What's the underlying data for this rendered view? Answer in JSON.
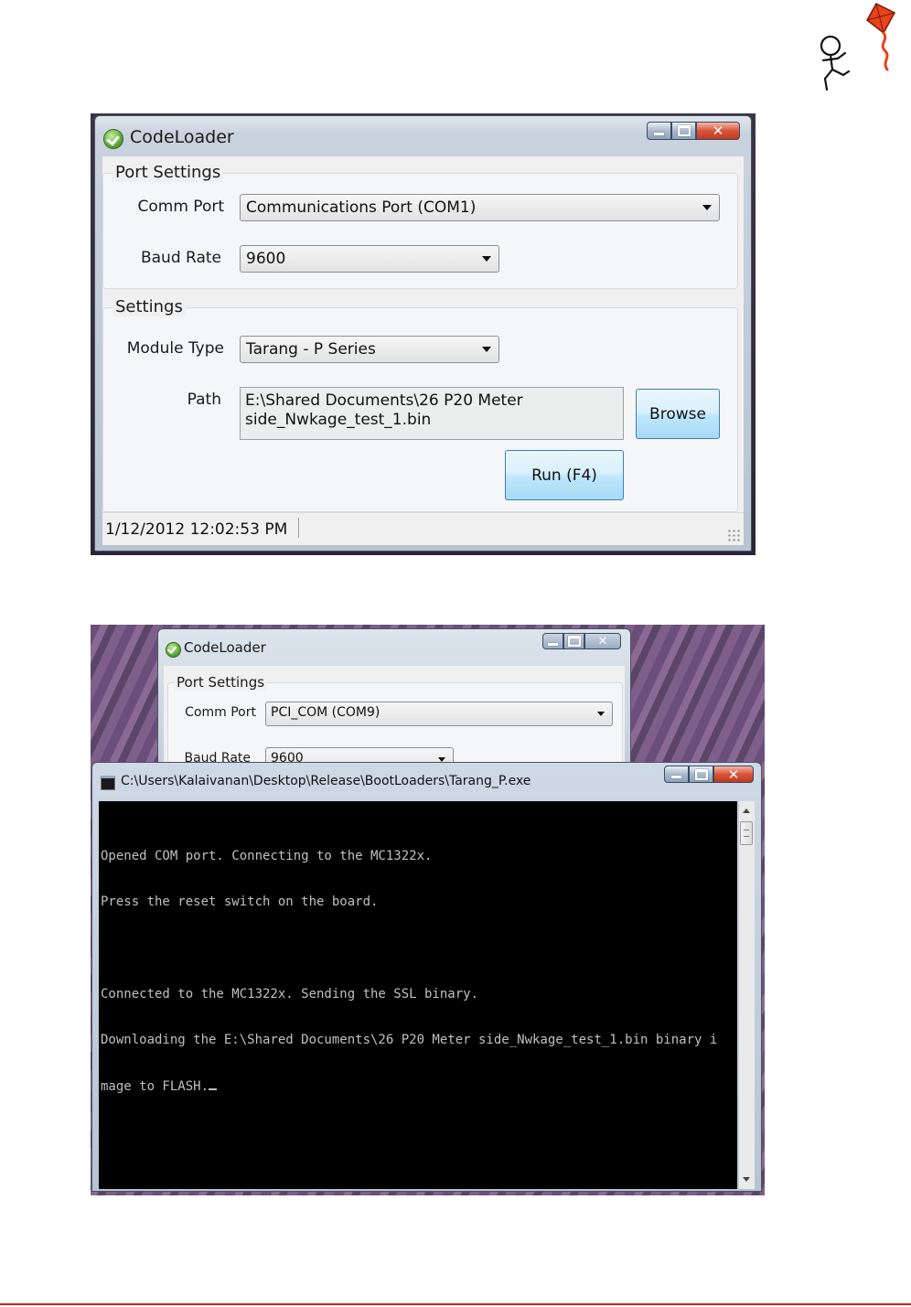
{
  "window1": {
    "title": "CodeLoader",
    "port_settings": {
      "legend": "Port Settings",
      "comm_port_label": "Comm Port",
      "comm_port_value": "Communications Port (COM1)",
      "baud_rate_label": "Baud Rate",
      "baud_rate_value": "9600"
    },
    "settings": {
      "legend": "Settings",
      "module_type_label": "Module Type",
      "module_type_value": "Tarang - P Series",
      "path_label": "Path",
      "path_line1": "E:\\Shared Documents\\26 P20 Meter",
      "path_line2": "side_Nwkage_test_1.bin",
      "browse_label": "Browse",
      "run_label": "Run (F4)"
    },
    "status": "1/12/2012 12:02:53 PM"
  },
  "window2": {
    "title": "CodeLoader",
    "port_settings_legend": "Port Settings",
    "comm_port_label": "Comm Port",
    "comm_port_value": "PCI_COM (COM9)",
    "baud_rate_label": "Baud Rate",
    "baud_rate_value": "9600"
  },
  "console": {
    "title": "C:\\Users\\Kalaivanan\\Desktop\\Release\\BootLoaders\\Tarang_P.exe",
    "lines": [
      "Opened COM port. Connecting to the MC1322x.",
      "Press the reset switch on the board.",
      "",
      "Connected to the MC1322x. Sending the SSL binary.",
      "Downloading the E:\\Shared Documents\\26 P20 Meter side_Nwkage_test_1.bin binary i",
      "mage to FLASH."
    ]
  },
  "colors": {
    "accent_red": "#d11f1f",
    "kite_red": "#e8431a",
    "button_blue": "#bee6fd"
  },
  "icons": {
    "logo": "stick-figure-kite-logo",
    "app": "green-check-shield-icon",
    "console": "console-window-icon"
  }
}
